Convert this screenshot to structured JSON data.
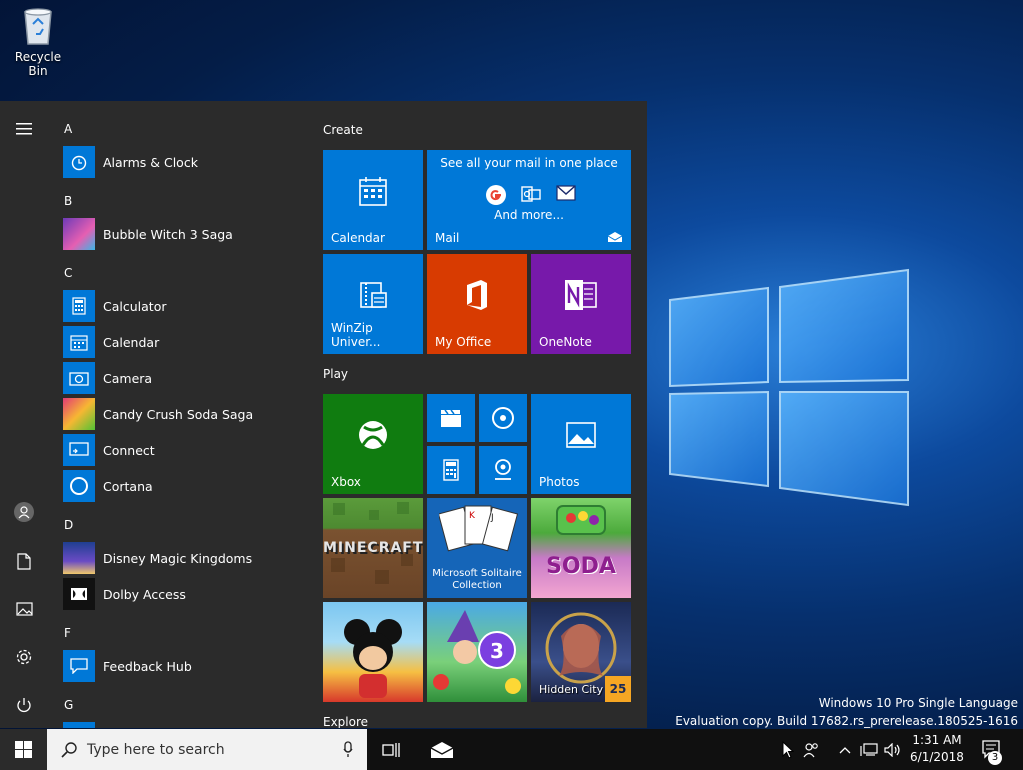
{
  "desktop": {
    "recycle_bin": "Recycle Bin"
  },
  "watermark": {
    "line1": "Windows 10 Pro Single Language",
    "line2": "Evaluation copy. Build 17682.rs_prerelease.180525-1616"
  },
  "app_list": {
    "letters": [
      "A",
      "B",
      "C",
      "D",
      "F",
      "G"
    ],
    "apps": [
      {
        "name": "Alarms & Clock",
        "icon": "alarm-clock-icon"
      },
      {
        "name": "Bubble Witch 3 Saga",
        "icon": "bubble-witch-icon"
      },
      {
        "name": "Calculator",
        "icon": "calculator-icon"
      },
      {
        "name": "Calendar",
        "icon": "calendar-icon"
      },
      {
        "name": "Camera",
        "icon": "camera-icon"
      },
      {
        "name": "Candy Crush Soda Saga",
        "icon": "candy-crush-icon"
      },
      {
        "name": "Connect",
        "icon": "connect-icon"
      },
      {
        "name": "Cortana",
        "icon": "cortana-icon"
      },
      {
        "name": "Disney Magic Kingdoms",
        "icon": "disney-icon"
      },
      {
        "name": "Dolby Access",
        "icon": "dolby-icon"
      },
      {
        "name": "Feedback Hub",
        "icon": "feedback-icon"
      }
    ]
  },
  "tiles": {
    "groups": [
      "Create",
      "Play",
      "Explore"
    ],
    "calendar": "Calendar",
    "mail": "Mail",
    "mail_header": "See all your mail in one place",
    "mail_more": "And more...",
    "winzip": "WinZip Univer...",
    "office": "My Office",
    "onenote": "OneNote",
    "xbox": "Xbox",
    "photos": "Photos",
    "minecraft": "MINECRAFT",
    "solitaire": "Microsoft Solitaire Collection",
    "soda": "SODA",
    "hidden_city": "Hidden City",
    "badge_25": "25"
  },
  "taskbar": {
    "search_placeholder": "Type here to search",
    "time": "1:31 AM",
    "date": "6/1/2018",
    "notifications": "3"
  },
  "colors": {
    "tile_blue": "#0078d7",
    "office_orange": "#d83b01",
    "onenote_purple": "#7719aa",
    "xbox_green": "#107c10"
  }
}
